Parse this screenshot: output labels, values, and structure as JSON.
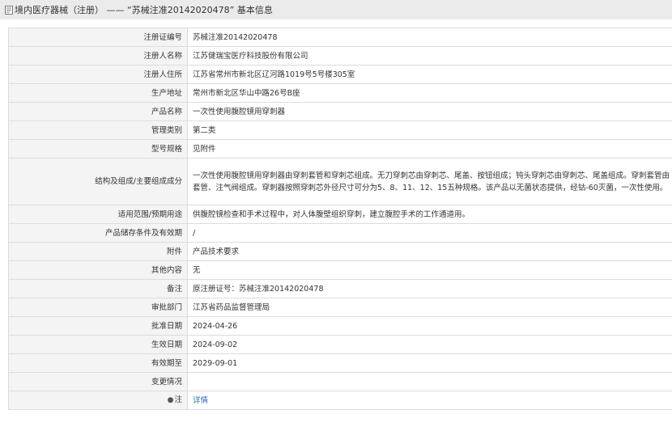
{
  "title": "境内医疗器械（注册） —— “苏械注准20142020478” 基本信息",
  "rows": [
    {
      "label": "注册证编号",
      "value": "苏械注准20142020478"
    },
    {
      "label": "注册人名称",
      "value": "江苏健瑞宝医疗科技股份有限公司"
    },
    {
      "label": "注册人住所",
      "value": "江苏省常州市新北区辽河路1019号5号楼305室"
    },
    {
      "label": "生产地址",
      "value": "常州市新北区华山中路26号B座"
    },
    {
      "label": "产品名称",
      "value": "一次性使用腹腔镜用穿刺器"
    },
    {
      "label": "管理类别",
      "value": "第二类"
    },
    {
      "label": "型号规格",
      "value": "见附件"
    },
    {
      "label": "结构及组成/主要组成成分",
      "value": "一次性使用腹腔镜用穿刺器由穿刺套管和穿刺芯组成。无刀穿刺芯由穿刺芯、尾盖、按钮组成；钝头穿刺芯由穿刺芯、尾盖组成。穿刺套管由套管、注气阀组成。穿刺器按照穿刺芯外径尺寸可分为5、8、11、12、15五种规格。该产品以无菌状态提供，经钴-60灭菌，一次性使用。"
    },
    {
      "label": "适用范围/预期用途",
      "value": "供腹腔镜检查和手术过程中，对人体腹壁组织穿刺，建立腹腔手术的工作通道用。"
    },
    {
      "label": "产品储存条件及有效期",
      "value": "/"
    },
    {
      "label": "附件",
      "value": "产品技术要求"
    },
    {
      "label": "其他内容",
      "value": "无"
    },
    {
      "label": "备注",
      "value": "原注册证号：苏械注准20142020478"
    },
    {
      "label": "审批部门",
      "value": "江苏省药品监督管理局"
    },
    {
      "label": "批准日期",
      "value": "2024-04-26"
    },
    {
      "label": "生效日期",
      "value": "2024-09-02"
    },
    {
      "label": "有效期至",
      "value": "2029-09-01"
    },
    {
      "label": "变更情况",
      "value": ""
    }
  ],
  "note_row": {
    "label": "注",
    "link": "详情",
    "icon": "pin-icon"
  }
}
